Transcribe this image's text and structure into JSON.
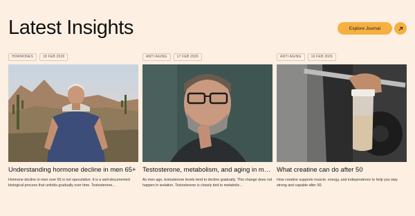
{
  "header": {
    "title": "Latest Insights",
    "explore_label": "Explore Journal",
    "explore_icon": "arrow-up-right-icon",
    "accent_color": "#f5b041"
  },
  "cards": [
    {
      "category": "HORMONES",
      "date": "18 FEB 2026",
      "image": "older-man-desert-photo",
      "title": "Understanding hormone decline in men 65+",
      "excerpt": "Hormone decline in men over 65 is not speculative. It is a well-documented biological process that unfolds gradually over time. Testosterone..."
    },
    {
      "category": "ANTI AGING",
      "date": "17 FEB 2026",
      "image": "man-glasses-portrait-photo",
      "title": "Testosterone, metabolism, and aging in men: What science really says",
      "excerpt": "As men age, testosterone levels tend to decline gradually. This change does not happen in isolation. Testosterone is closely tied to metabolic..."
    },
    {
      "category": "ANTI AGING",
      "date": "16 FEB 2026",
      "image": "shaker-bottle-gym-photo",
      "title": "What creatine can do after 50",
      "excerpt": "How creatine supports muscle, energy, and independence to help you stay strong and capable after 50."
    }
  ]
}
